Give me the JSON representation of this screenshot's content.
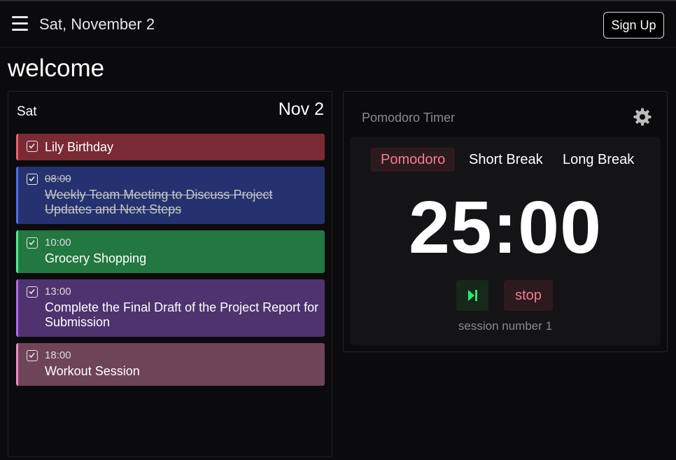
{
  "header": {
    "date": "Sat, November 2",
    "signup_label": "Sign Up"
  },
  "welcome": "welcome",
  "day": {
    "name": "Sat",
    "date": "Nov 2",
    "events": [
      {
        "time": "",
        "title": "Lily Birthday",
        "color": "#7a2a35",
        "border": "#f06070",
        "done": false
      },
      {
        "time": "08:00",
        "title": "Weekly Team Meeting to Discuss Project Updates and Next Steps",
        "color": "#25326f",
        "border": "#4f6cf0",
        "done": true
      },
      {
        "time": "10:00",
        "title": "Grocery Shopping",
        "color": "#227840",
        "border": "#4ef08a",
        "done": false
      },
      {
        "time": "13:00",
        "title": "Complete the Final Draft of the Project Report for Submission",
        "color": "#4f336f",
        "border": "#b06cf0",
        "done": false
      },
      {
        "time": "18:00",
        "title": "Workout Session",
        "color": "#6e4458",
        "border": "#f08abf",
        "done": false
      }
    ]
  },
  "pomodoro": {
    "title": "Pomodoro Timer",
    "tabs": [
      "Pomodoro",
      "Short Break",
      "Long Break"
    ],
    "active_tab": "Pomodoro",
    "timer": "25:00",
    "stop_label": "stop",
    "session": "session number 1",
    "accent": "#f07e93",
    "play_color": "#2ee66a"
  },
  "icons": {
    "menu": "hamburger-menu-icon",
    "settings": "gear-icon",
    "checkbox": "checkbox-checked-icon",
    "play": "play-skip-icon"
  }
}
